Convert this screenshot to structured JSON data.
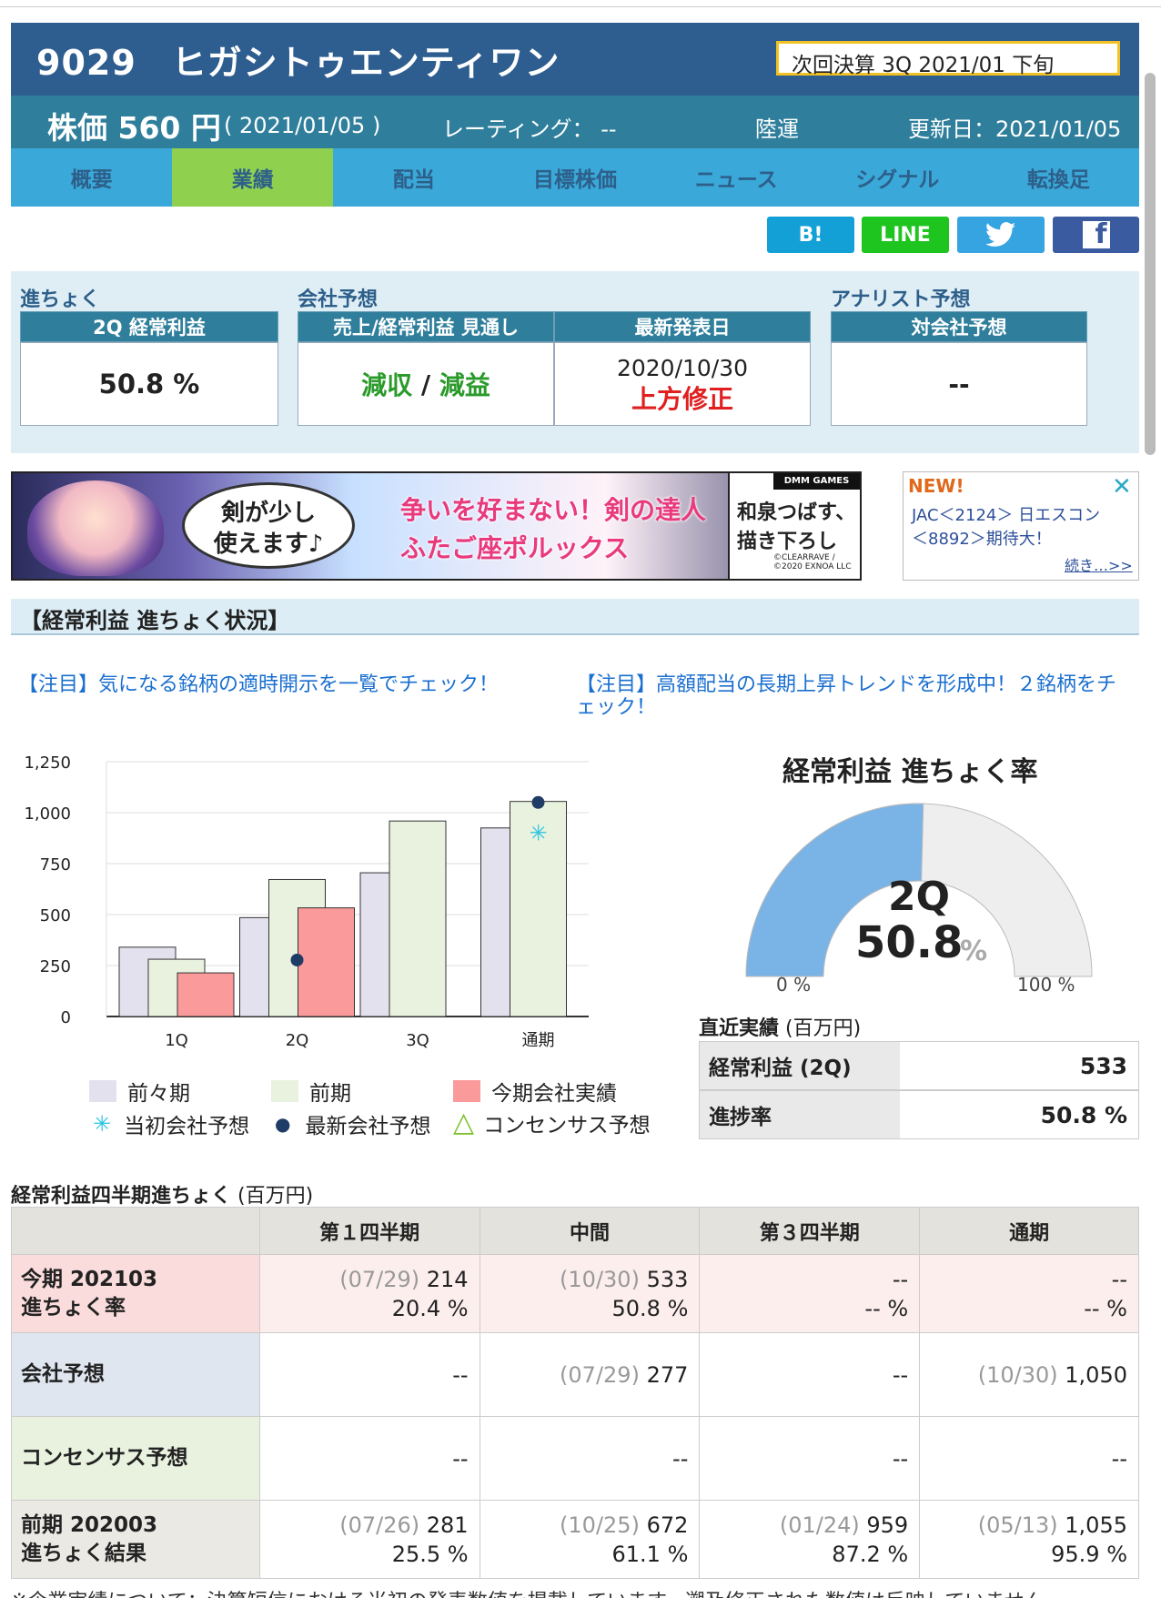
{
  "header": {
    "code": "9029",
    "name": "ヒガシトゥエンティワン",
    "next_settlement": "次回決算 3Q 2021/01 下旬",
    "price_label": "株価 560 円",
    "price_date": "( 2021/01/05 )",
    "rating": "レーティング： --",
    "sector": "陸運",
    "updated": "更新日：2021/01/05"
  },
  "tabs": [
    "概要",
    "業績",
    "配当",
    "目標株価",
    "ニュース",
    "シグナル",
    "転換足"
  ],
  "active_tab": "業績",
  "share": {
    "hatena": "B!",
    "line": "LINE",
    "twitter": "twitter-icon",
    "facebook": "f"
  },
  "summary": {
    "progress_label": "進ちょく",
    "forecast_label": "会社予想",
    "analyst_label": "アナリスト予想",
    "box1_head": "2Q 経常利益",
    "box1_value": "50.8 %",
    "box2_head": "売上/経常利益 見通し",
    "box2_rev": "減収",
    "box2_sep": " / ",
    "box2_profit": "減益",
    "box3_head": "最新発表日",
    "box3_date": "2020/10/30",
    "box3_revision": "上方修正",
    "box4_head": "対会社予想",
    "box4_value": "--"
  },
  "ads": {
    "banner_bubble_1": "剣が少し",
    "banner_bubble_2": "使えます♪",
    "banner_main_1": "争いを好まない！剣の達人",
    "banner_main_2": "ふたご座ポルックス",
    "banner_brand": "DMM GAMES",
    "banner_voice_1": "和泉つばす、",
    "banner_voice_2": "描き下ろし",
    "banner_copy_1": "©CLEARRAVE /",
    "banner_copy_2": "©2020 EXNOA LLC",
    "side_new": "NEW!",
    "side_line1": "JAC＜2124＞ 日エスコン",
    "side_line2": "＜8892＞期待大！",
    "side_more": "続き…>>"
  },
  "section_title": "【経常利益 進ちょく状況】",
  "notices": [
    "【注目】気になる銘柄の適時開示を一覧でチェック！",
    "【注目】高額配当の長期上昇トレンドを形成中！２銘柄をチェック！"
  ],
  "chart_data": {
    "type": "bar",
    "categories": [
      "1Q",
      "2Q",
      "3Q",
      "通期"
    ],
    "y_ticks": [
      "0",
      "250",
      "500",
      "750",
      "1,000",
      "1,250"
    ],
    "ylim": [
      0,
      1250
    ],
    "grid": "horizontal",
    "series": [
      {
        "name": "前々期",
        "color": "#e4e1ee",
        "values": [
          340,
          485,
          705,
          925
        ]
      },
      {
        "name": "前期",
        "color": "#e8f2df",
        "values": [
          281,
          672,
          959,
          1055
        ]
      },
      {
        "name": "今期会社実績",
        "color": "#fa9a9a",
        "values": [
          214,
          533,
          null,
          null
        ]
      }
    ],
    "markers": [
      {
        "name": "当初会社予想",
        "symbol": "✳",
        "color": "#29c4e0",
        "points": [
          {
            "x": "通期",
            "y": 900
          }
        ]
      },
      {
        "name": "最新会社予想",
        "symbol": "●",
        "color": "#1f3c66",
        "points": [
          {
            "x": "2Q",
            "y": 277
          },
          {
            "x": "通期",
            "y": 1050
          }
        ]
      },
      {
        "name": "コンセンサス予想",
        "symbol": "△",
        "color": "#7bc12a",
        "points": []
      }
    ]
  },
  "gauge": {
    "title": "経常利益 進ちょく率",
    "period": "2Q",
    "value": "50.8",
    "pct_symbol": "%",
    "fraction": 0.508,
    "min_label": "0 %",
    "max_label": "100 %",
    "fill_color": "#7ab3e6",
    "track_color": "#eeeeee"
  },
  "recent": {
    "title": "直近実績",
    "unit": " (百万円)",
    "rows": [
      {
        "k": "経常利益 (2Q)",
        "v": "533"
      },
      {
        "k": "進捗率",
        "v": "50.8 %"
      }
    ]
  },
  "quarterly": {
    "title": "経常利益四半期進ちょく",
    "unit": " (百万円)",
    "columns": [
      "第１四半期",
      "中間",
      "第３四半期",
      "通期"
    ],
    "rows": [
      {
        "head1": "今期 202103",
        "head2": "進ちょく率",
        "cells": [
          {
            "date": "(07/29)",
            "val": " 214",
            "sub": "20.4 %"
          },
          {
            "date": "(10/30)",
            "val": " 533",
            "sub": "50.8 %"
          },
          {
            "date": "",
            "val": "--",
            "sub": "-- %"
          },
          {
            "date": "",
            "val": "--",
            "sub": "-- %"
          }
        ]
      },
      {
        "head1": "会社予想",
        "head2": "",
        "cells": [
          {
            "date": "",
            "val": "--",
            "sub": ""
          },
          {
            "date": "(07/29)",
            "val": " 277",
            "sub": ""
          },
          {
            "date": "",
            "val": "--",
            "sub": ""
          },
          {
            "date": "(10/30)",
            "val": " 1,050",
            "sub": ""
          }
        ]
      },
      {
        "head1": "コンセンサス予想",
        "head2": "",
        "cells": [
          {
            "date": "",
            "val": "--",
            "sub": ""
          },
          {
            "date": "",
            "val": "--",
            "sub": ""
          },
          {
            "date": "",
            "val": "--",
            "sub": ""
          },
          {
            "date": "",
            "val": "--",
            "sub": ""
          }
        ]
      },
      {
        "head1": "前期 202003",
        "head2": "進ちょく結果",
        "cells": [
          {
            "date": "(07/26)",
            "val": " 281",
            "sub": "25.5 %"
          },
          {
            "date": "(10/25)",
            "val": " 672",
            "sub": "61.1 %"
          },
          {
            "date": "(01/24)",
            "val": " 959",
            "sub": "87.2 %"
          },
          {
            "date": "(05/13)",
            "val": " 1,055",
            "sub": "95.9 %"
          }
        ]
      }
    ]
  },
  "footnote": "※企業実績について：決算短信における当初の発表数値を掲載しています。遡及修正された数値は反映していません。"
}
